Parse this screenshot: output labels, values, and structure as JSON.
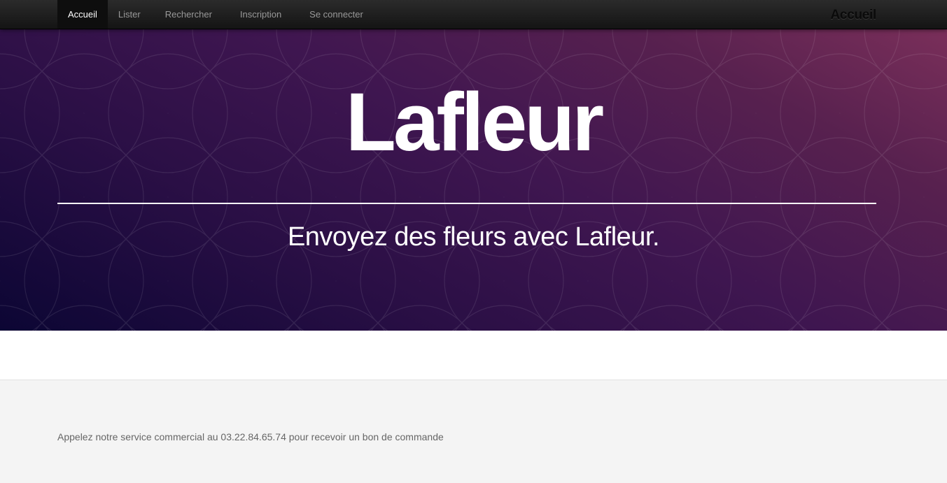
{
  "navbar": {
    "items": [
      {
        "label": "Accueil",
        "active": true
      },
      {
        "label": "Lister",
        "active": false
      },
      {
        "label": "Rechercher",
        "active": false
      },
      {
        "label": "Inscription",
        "active": false
      },
      {
        "label": "Se connecter",
        "active": false
      }
    ],
    "brand": "Accueil"
  },
  "hero": {
    "title": "Lafleur",
    "subtitle": "Envoyez des fleurs avec Lafleur."
  },
  "footer": {
    "text": "Appelez notre service commercial au 03.22.84.65.74 pour recevoir un bon de commande"
  },
  "colors": {
    "navbar": "#1c1c1c",
    "hero_gradient_start": "#0c0634",
    "hero_gradient_end": "#7a2f5a",
    "footer_bg": "#f4f4f4",
    "footer_text": "#666666"
  }
}
